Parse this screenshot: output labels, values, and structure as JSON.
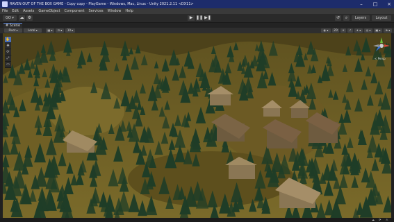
{
  "window": {
    "title": "RAVEN OUT OF THE BOX GAME - Copy copy - PlayGame - Windows, Mac, Linux - Unity 2021.2.11 <DX11>",
    "controls": {
      "minimize": "–",
      "maximize": "□",
      "close": "×"
    }
  },
  "menu": {
    "items": [
      "File",
      "Edit",
      "Assets",
      "GameObject",
      "Component",
      "Services",
      "Window",
      "Help"
    ]
  },
  "toolbar": {
    "account_label": "GO ▾",
    "cloud_label": "☁",
    "collab_label": "⚙",
    "play_label": "▶",
    "pause_label": "❚❚",
    "step_label": "▶❚",
    "history_label": "↺",
    "search_label": "⌕",
    "layers_label": "Layers",
    "layout_label": "Layout"
  },
  "scene": {
    "tab_label": "# Scene",
    "pivot_label": "Pivot ▾",
    "local_label": "Local ▾",
    "grid_label": "▦ ▾",
    "snap_label": "⊡ ▾",
    "increment_label": "10 ▾",
    "view_label": "◐ ▾",
    "two_d_label": "2D",
    "light_label": "☀",
    "audio_label": "♪",
    "fx_label": "✦ ▾",
    "hidden_label": "◎ ▾",
    "camera_label": "▣ ▾",
    "gizmos_label": "⊕ ▾",
    "persp_label": "< Persp"
  },
  "tools": {
    "items": [
      "✋",
      "✥",
      "⟳",
      "⤢",
      "▭"
    ]
  },
  "colors": {
    "title_bar": "#1d2c6b",
    "menu_bar": "#3a3a3a",
    "ground": "#6a5a22",
    "tree": "#1f3d27",
    "roof": "#7d6a4c",
    "accent": "#4a6fb8"
  }
}
